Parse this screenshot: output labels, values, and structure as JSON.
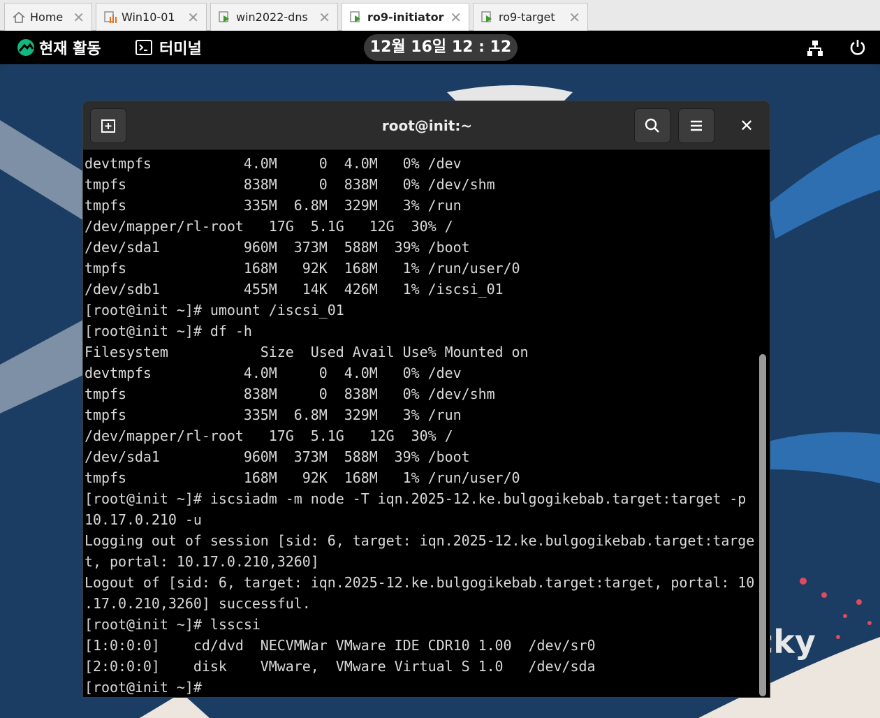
{
  "tabs": [
    {
      "label": "Home"
    },
    {
      "label": "Win10-01"
    },
    {
      "label": "win2022-dns"
    },
    {
      "label": "ro9-initiator"
    },
    {
      "label": "ro9-target"
    }
  ],
  "topbar": {
    "activities": "현재 활동",
    "app_name": "터미널",
    "clock": "12월 16일  12 : 12"
  },
  "desktop": {
    "wallpaper_text": "cky"
  },
  "terminal": {
    "title": "root@init:~",
    "lines": [
      "devtmpfs           4.0M     0  4.0M   0% /dev",
      "tmpfs              838M     0  838M   0% /dev/shm",
      "tmpfs              335M  6.8M  329M   3% /run",
      "/dev/mapper/rl-root   17G  5.1G   12G  30% /",
      "/dev/sda1          960M  373M  588M  39% /boot",
      "tmpfs              168M   92K  168M   1% /run/user/0",
      "/dev/sdb1          455M   14K  426M   1% /iscsi_01",
      "[root@init ~]# umount /iscsi_01",
      "[root@init ~]# df -h",
      "Filesystem           Size  Used Avail Use% Mounted on",
      "devtmpfs           4.0M     0  4.0M   0% /dev",
      "tmpfs              838M     0  838M   0% /dev/shm",
      "tmpfs              335M  6.8M  329M   3% /run",
      "/dev/mapper/rl-root   17G  5.1G   12G  30% /",
      "/dev/sda1          960M  373M  588M  39% /boot",
      "tmpfs              168M   92K  168M   1% /run/user/0",
      "[root@init ~]# iscsiadm -m node -T iqn.2025-12.ke.bulgogikebab.target:target -p",
      "10.17.0.210 -u",
      "Logging out of session [sid: 6, target: iqn.2025-12.ke.bulgogikebab.target:targe",
      "t, portal: 10.17.0.210,3260]",
      "Logout of [sid: 6, target: iqn.2025-12.ke.bulgogikebab.target:target, portal: 10",
      ".17.0.210,3260] successful.",
      "[root@init ~]# lsscsi",
      "[1:0:0:0]    cd/dvd  NECVMWar VMware IDE CDR10 1.00  /dev/sr0",
      "[2:0:0:0]    disk    VMware,  VMware Virtual S 1.0   /dev/sda",
      "[root@init ~]#"
    ]
  }
}
